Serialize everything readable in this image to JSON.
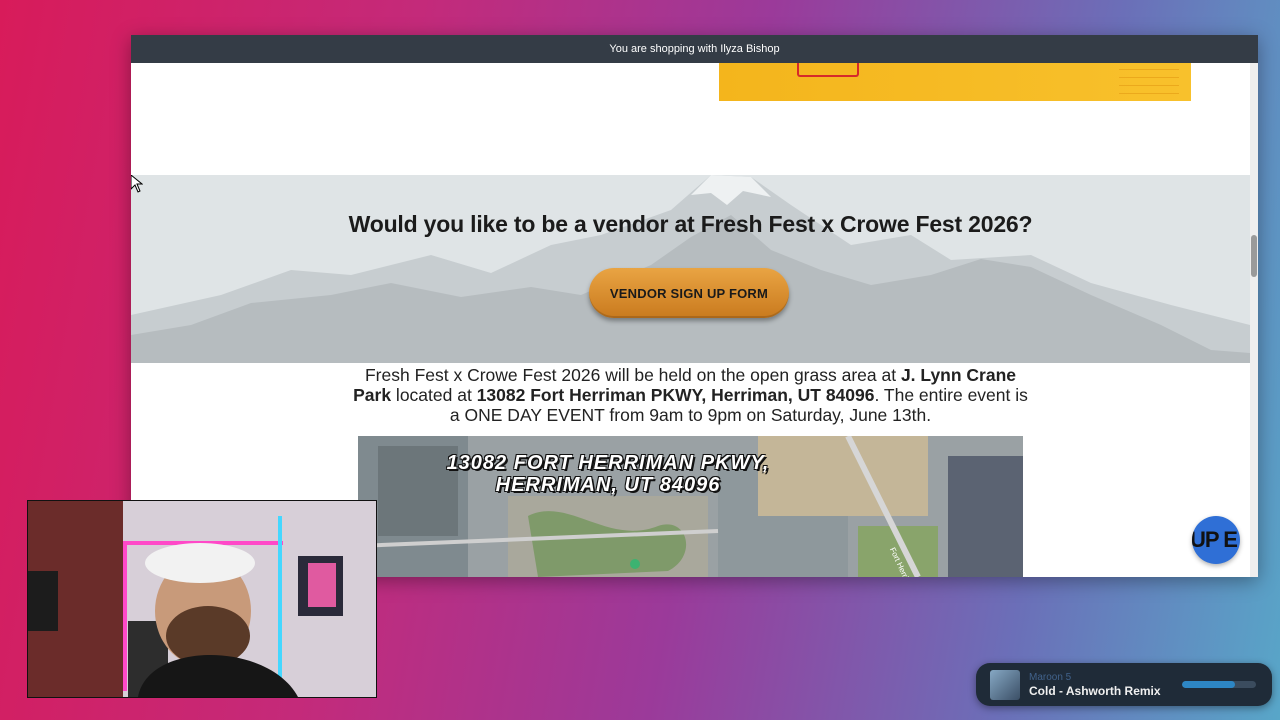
{
  "shop_bar": {
    "text": "You are shopping with Ilyza Bishop"
  },
  "hero": {
    "title": "Would you like to be a vendor at Fresh Fest x Crowe Fest 2026?",
    "button_label": "VENDOR SIGN UP FORM"
  },
  "event_info": {
    "part1": "Fresh Fest x Crowe Fest 2026 will be held on the open grass area at ",
    "venue": "J. Lynn Crane Park",
    "part2": " located at ",
    "address": "13082 Fort Herriman PKWY, Herriman, UT 84096",
    "part3": ". The entire event is a ONE DAY EVENT from 9am to 9pm on Saturday, June 13th."
  },
  "map": {
    "caption_line1": "13082 FORT HERRIMAN PKWY,",
    "caption_line2": "HERRIMAN, UT 84096",
    "street_label": "Fort Herri"
  },
  "chat_bubble": {
    "text": "UP E"
  },
  "music": {
    "artist": "Maroon 5",
    "song": "Cold - Ashworth Remix",
    "progress": 0.72,
    "accent_color": "#2d86c4"
  },
  "colors": {
    "button": "#d88a2e",
    "shop_bar": "#343c46",
    "banner": "#f6bb24"
  }
}
